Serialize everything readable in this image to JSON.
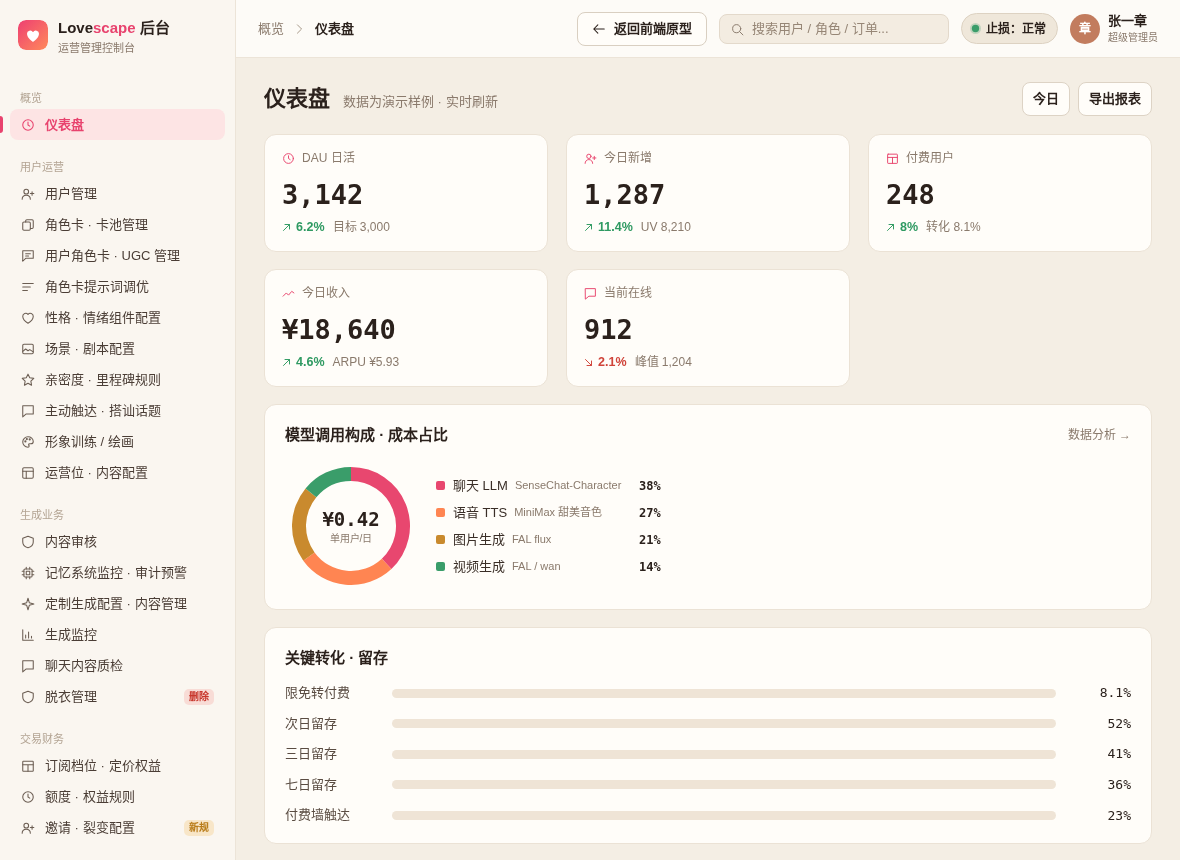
{
  "brand": {
    "title_parts": [
      {
        "text": "Love",
        "accent": false
      },
      {
        "text": "scape",
        "accent": true
      },
      {
        "text": " 后台",
        "accent": false
      }
    ],
    "subtitle": "运营管理控制台"
  },
  "sidebar": {
    "sections": [
      {
        "title": "概览",
        "items": [
          {
            "label": "仪表盘",
            "selected": true
          }
        ]
      },
      {
        "title": "用户运营",
        "items": [
          {
            "label": "用户管理",
            "selected": false
          },
          {
            "label": "角色卡 · 卡池管理",
            "selected": false
          },
          {
            "label": "用户角色卡 · UGC 管理",
            "selected": false
          },
          {
            "label": "角色卡提示词调优",
            "selected": false
          },
          {
            "label": "性格 · 情绪组件配置",
            "selected": false
          },
          {
            "label": "场景 · 剧本配置",
            "selected": false
          },
          {
            "label": "亲密度 · 里程碑规则",
            "selected": false
          },
          {
            "label": "主动触达 · 搭讪话题",
            "selected": false
          },
          {
            "label": "形象训练 / 绘画",
            "selected": false
          },
          {
            "label": "运营位 · 内容配置",
            "selected": false
          }
        ]
      },
      {
        "title": "生成业务",
        "items": [
          {
            "label": "内容审核",
            "selected": false
          },
          {
            "label": "记忆系统监控 · 审计预警",
            "selected": false
          },
          {
            "label": "定制生成配置 · 内容管理",
            "selected": false
          },
          {
            "label": "生成监控",
            "selected": false
          },
          {
            "label": "聊天内容质检",
            "selected": false
          },
          {
            "label": "脱衣管理",
            "selected": false,
            "badge": {
              "text": "删除",
              "kind": "danger"
            }
          }
        ]
      },
      {
        "title": "交易财务",
        "items": [
          {
            "label": "订阅档位 · 定价权益",
            "selected": false
          },
          {
            "label": "额度 · 权益规则",
            "selected": false
          },
          {
            "label": "邀请 · 裂变配置",
            "selected": false,
            "badge": {
              "text": "新规",
              "kind": "warning"
            }
          }
        ]
      }
    ]
  },
  "topbar": {
    "breadcrumb": [
      {
        "label": "概览",
        "selected": false
      },
      {
        "label": "仪表盘",
        "selected": true
      }
    ],
    "back_button": "返回前端原型",
    "search": {
      "placeholder": "搜索用户 / 角色 / 订单..."
    },
    "status": {
      "label": "止损：正常",
      "ok": true
    },
    "user": {
      "avatar_initial": "章",
      "name": "张一章",
      "role": "超级管理员"
    }
  },
  "page": {
    "title": "仪表盘",
    "subtitle": "数据为演示样例 · 实时刷新",
    "actions": [
      "今日",
      "导出报表"
    ]
  },
  "stats": [
    {
      "label": "DAU 日活",
      "value": "3,142",
      "rising": true,
      "change": "6.2%",
      "note": "目标 3,000"
    },
    {
      "label": "今日新增",
      "value": "1,287",
      "rising": true,
      "change": "11.4%",
      "note": "UV 8,210"
    },
    {
      "label": "付费用户",
      "value": "248",
      "rising": true,
      "change": "8%",
      "note": "转化 8.1%"
    },
    {
      "label": "今日收入",
      "value": "¥18,640",
      "rising": true,
      "change": "4.6%",
      "note": "ARPU ¥5.93"
    },
    {
      "label": "当前在线",
      "value": "912",
      "rising": false,
      "change": "2.1%",
      "note": "峰值 1,204"
    }
  ],
  "cost_card": {
    "title": "模型调用构成 · 成本占比",
    "link": "数据分析 →",
    "center_value": "¥0.42",
    "center_caption": "单用户/日",
    "chart_data": {
      "type": "donut",
      "categories": [
        "聊天 LLM",
        "语音 TTS",
        "图片生成",
        "视频生成"
      ],
      "values": [
        38,
        27,
        21,
        14
      ]
    },
    "legend": [
      {
        "model": "SenseChat-Character",
        "percent": "38%",
        "color": "#e8476f"
      },
      {
        "model": "MiniMax 甜美音色",
        "percent": "27%",
        "color": "#ff8552"
      },
      {
        "model": "FAL flux",
        "percent": "21%",
        "color": "#c98a2e"
      },
      {
        "model": "FAL / wan",
        "percent": "14%",
        "color": "#3a9d6a"
      }
    ]
  },
  "retention_card": {
    "title": "关键转化 · 留存",
    "rows": [
      {
        "label": "限免转付费",
        "level": 0,
        "value": "8.1%"
      },
      {
        "label": "次日留存",
        "level": 0,
        "value": "52%"
      },
      {
        "label": "三日留存",
        "level": 0,
        "value": "41%"
      },
      {
        "label": "七日留存",
        "level": 0,
        "value": "36%"
      },
      {
        "label": "付费墙触达",
        "level": 0,
        "value": "23%"
      }
    ]
  }
}
